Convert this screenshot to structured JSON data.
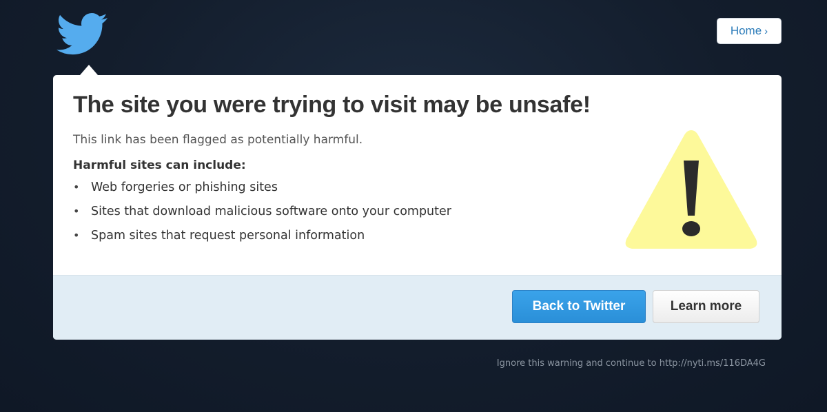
{
  "logo": {
    "icon": "twitter-bird-icon",
    "color": "#55acee"
  },
  "header": {
    "home_label": "Home",
    "home_chevron": "›"
  },
  "card": {
    "title": "The site you were trying to visit may be unsafe!",
    "subtitle": "This link has been flagged as potentially harmful.",
    "harm_heading": "Harmful sites can include:",
    "harm_items": [
      "Web forgeries or phishing sites",
      "Sites that download malicious software onto your computer",
      "Spam sites that request personal information"
    ],
    "warning_icon": "warning-triangle-icon"
  },
  "footer": {
    "primary_label": "Back to Twitter",
    "secondary_label": "Learn more"
  },
  "ignore": {
    "text": "Ignore this warning and continue to",
    "link": "http://nyti.ms/116DA4G"
  },
  "colors": {
    "primary_button": "#2f96e0",
    "warning_fill": "#fdf99a",
    "footer_bg": "#e1edf5",
    "page_bg": "#131d2c"
  }
}
